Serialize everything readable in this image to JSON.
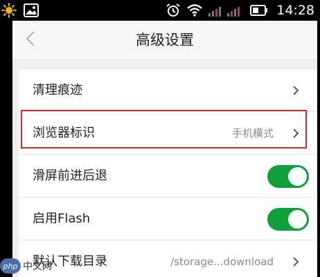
{
  "status_bar": {
    "time": "14:28",
    "icons": [
      "weather-sun-icon",
      "image-icon",
      "alarm-icon",
      "wifi-icon",
      "signal-icon",
      "battery-icon"
    ]
  },
  "header": {
    "title": "高级设置",
    "back_icon": "chevron-left-icon"
  },
  "settings": {
    "items": [
      {
        "label": "清理痕迹",
        "value": "",
        "control": "chevron"
      },
      {
        "label": "浏览器标识",
        "value": "手机模式",
        "control": "chevron",
        "highlighted": true
      },
      {
        "label": "滑屏前进后退",
        "control": "toggle",
        "on": true
      },
      {
        "label": "启用Flash",
        "control": "toggle",
        "on": true
      },
      {
        "label": "默认下载目录",
        "value": "/storage...download",
        "control": "chevron"
      }
    ]
  },
  "colors": {
    "toggle_on": "#0e9f3a",
    "highlight": "#d9252b",
    "background": "#efefef"
  },
  "watermark": {
    "badge": "php",
    "text": "中文网"
  }
}
